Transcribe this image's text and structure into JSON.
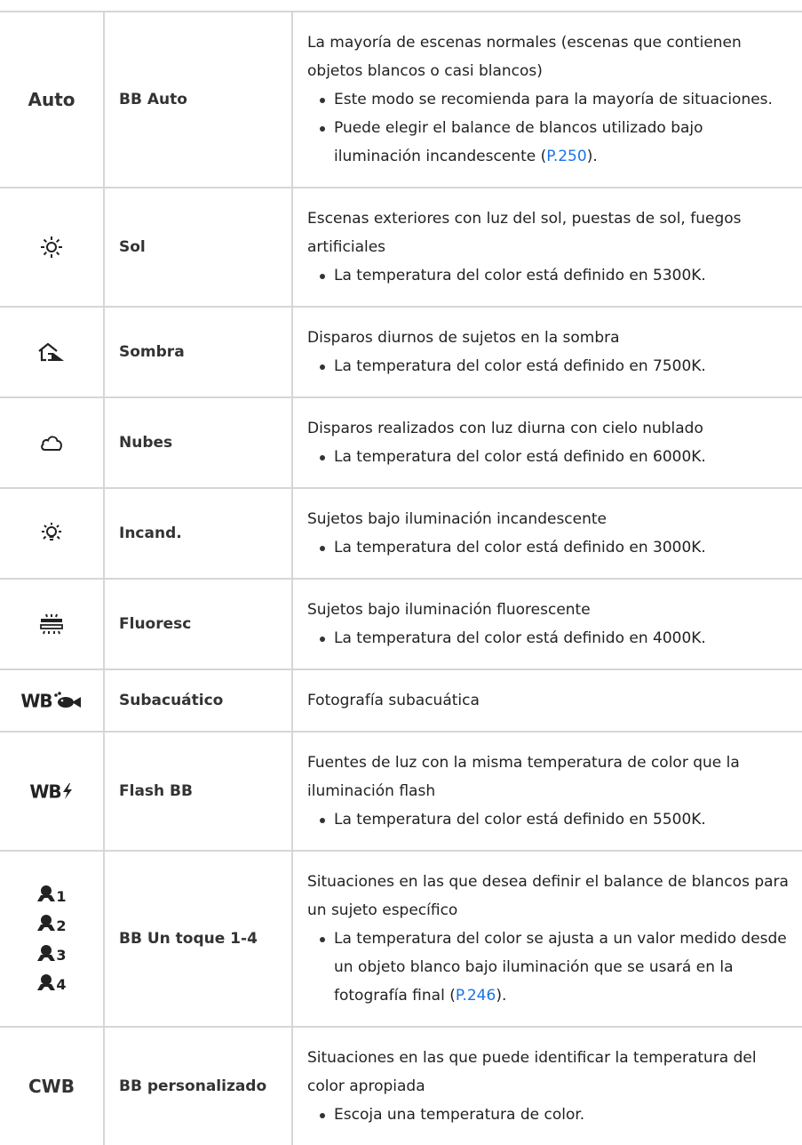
{
  "rows": [
    {
      "icon_text": "Auto",
      "mode": "BB Auto",
      "desc": "La mayoría de escenas normales (escenas que contienen objetos blancos o casi blancos)",
      "bullets": [
        "Este modo se recomienda para la mayoría de situaciones.",
        "Puede elegir el balance de blancos utilizado bajo iluminación incandescente ("
      ],
      "link": "P.250",
      "link_tail": ")."
    },
    {
      "icon": "sun-icon",
      "mode": "Sol",
      "desc": "Escenas exteriores con luz del sol, puestas de sol, fuegos artificiales",
      "bullets": [
        "La temperatura del color está definido en 5300K."
      ]
    },
    {
      "icon": "shade-icon",
      "mode": "Sombra",
      "desc": "Disparos diurnos de sujetos en la sombra",
      "bullets": [
        "La temperatura del color está definido en 7500K."
      ]
    },
    {
      "icon": "cloud-icon",
      "mode": "Nubes",
      "desc": "Disparos realizados con luz diurna con cielo nublado",
      "bullets": [
        "La temperatura del color está definido en 6000K."
      ]
    },
    {
      "icon": "incandescent-icon",
      "mode": "Incand.",
      "desc": "Sujetos bajo iluminación incandescente",
      "bullets": [
        "La temperatura del color está definido en 3000K."
      ]
    },
    {
      "icon": "fluorescent-icon",
      "mode": "Fluoresc",
      "desc": "Sujetos bajo iluminación fluorescente",
      "bullets": [
        "La temperatura del color está definido en 4000K."
      ]
    },
    {
      "icon": "underwater-icon",
      "icon_label": "WB",
      "mode": "Subacuático",
      "desc": "Fotografía subacuática"
    },
    {
      "icon": "flash-icon",
      "icon_label": "WB",
      "mode": "Flash BB",
      "desc": "Fuentes de luz con la misma temperatura de color que la iluminación flash",
      "bullets": [
        "La temperatura del color está definido en 5500K."
      ]
    },
    {
      "icon": "one-touch-icon",
      "icon_digits": [
        "1",
        "2",
        "3",
        "4"
      ],
      "mode": "BB Un toque 1-4",
      "desc": "Situaciones en las que desea definir el balance de blancos para un sujeto específico",
      "bullets": [
        "La temperatura del color se ajusta a un valor medido desde un objeto blanco bajo iluminación que se usará en la fotografía final ("
      ],
      "link": "P.246",
      "link_tail": ")."
    },
    {
      "icon_text": "CWB",
      "mode": "BB personalizado",
      "desc": "Situaciones en las que puede identificar la temperatura del color apropiada",
      "bullets": [
        "Escoja una temperatura de color."
      ]
    }
  ],
  "colors": {
    "link": "#1a73e8",
    "border": "#d6d6d6",
    "text": "#222222"
  }
}
